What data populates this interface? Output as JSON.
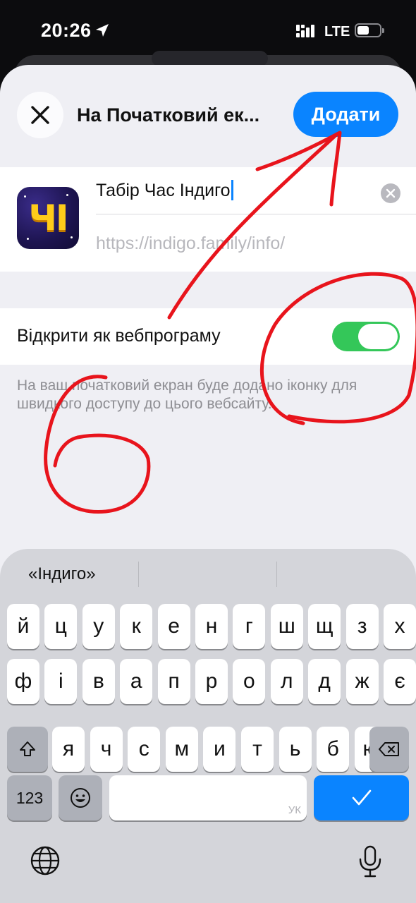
{
  "status_bar": {
    "time": "20:26",
    "network": "LTE"
  },
  "sheet": {
    "title": "На Початковий ек...",
    "add_button": "Додати"
  },
  "bookmark": {
    "app_icon_text": "ЧІ",
    "name_value": "Табір Час Індиго",
    "url": "https://indigo.family/info/"
  },
  "web_app": {
    "label": "Відкрити як вебпрограму",
    "enabled": true
  },
  "caption": "На ваш початковий екран буде додано іконку для швидкого доступу до цього вебсайту.",
  "keyboard": {
    "suggestions": [
      "«Індиго»",
      "",
      ""
    ],
    "row1": [
      "й",
      "ц",
      "у",
      "к",
      "е",
      "н",
      "г",
      "ш",
      "щ",
      "з",
      "х"
    ],
    "row2": [
      "ф",
      "і",
      "в",
      "а",
      "п",
      "р",
      "о",
      "л",
      "д",
      "ж",
      "є"
    ],
    "row3": [
      "я",
      "ч",
      "с",
      "м",
      "и",
      "т",
      "ь",
      "б",
      "ю"
    ],
    "numbers_key": "123",
    "space_hint": "УК"
  },
  "annotations": {
    "color": "#e8141c",
    "handwritten_digit": "6"
  }
}
